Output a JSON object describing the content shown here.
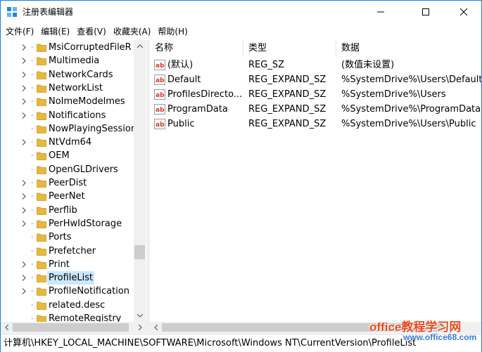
{
  "window": {
    "title": "注册表编辑器",
    "controls": {
      "minimize": "minimize-icon",
      "maximize": "maximize-icon",
      "close": "close-icon"
    }
  },
  "menu": [
    "文件(F)",
    "编辑(E)",
    "查看(V)",
    "收藏夹(A)",
    "帮助(H)"
  ],
  "tree": {
    "items": [
      {
        "label": "MsiCorruptedFileR",
        "expandable": true
      },
      {
        "label": "Multimedia",
        "expandable": true
      },
      {
        "label": "NetworkCards",
        "expandable": true
      },
      {
        "label": "NetworkList",
        "expandable": true
      },
      {
        "label": "NoImeModelmes",
        "expandable": true
      },
      {
        "label": "Notifications",
        "expandable": true
      },
      {
        "label": "NowPlayingSession",
        "expandable": false
      },
      {
        "label": "NtVdm64",
        "expandable": true
      },
      {
        "label": "OEM",
        "expandable": false
      },
      {
        "label": "OpenGLDrivers",
        "expandable": false
      },
      {
        "label": "PeerDist",
        "expandable": true
      },
      {
        "label": "PeerNet",
        "expandable": true
      },
      {
        "label": "Perflib",
        "expandable": true
      },
      {
        "label": "PerHwIdStorage",
        "expandable": true
      },
      {
        "label": "Ports",
        "expandable": false
      },
      {
        "label": "Prefetcher",
        "expandable": false
      },
      {
        "label": "Print",
        "expandable": true
      },
      {
        "label": "ProfileList",
        "expandable": true,
        "selected": true
      },
      {
        "label": "ProfileNotification",
        "expandable": true
      },
      {
        "label": "related.desc",
        "expandable": false
      },
      {
        "label": "RemoteRegistry",
        "expandable": false
      }
    ]
  },
  "list": {
    "columns": {
      "name": "名称",
      "type": "类型",
      "data": "数据"
    },
    "rows": [
      {
        "name": "(默认)",
        "type": "REG_SZ",
        "data": "(数值未设置)"
      },
      {
        "name": "Default",
        "type": "REG_EXPAND_SZ",
        "data": "%SystemDrive%\\Users\\Default"
      },
      {
        "name": "ProfilesDirecto...",
        "type": "REG_EXPAND_SZ",
        "data": "%SystemDrive%\\Users"
      },
      {
        "name": "ProgramData",
        "type": "REG_EXPAND_SZ",
        "data": "%SystemDrive%\\ProgramData"
      },
      {
        "name": "Public",
        "type": "REG_EXPAND_SZ",
        "data": "%SystemDrive%\\Users\\Public"
      }
    ]
  },
  "status": {
    "path": "计算机\\HKEY_LOCAL_MACHINE\\SOFTWARE\\Microsoft\\Windows NT\\CurrentVersion\\ProfileList"
  },
  "watermark": {
    "main": "office教程学习网",
    "sub": "www.office68.com"
  },
  "colors": {
    "accent": "#1883d7",
    "selection": "#cce8ff",
    "folder": "#e8b83a",
    "watermark_red": "#e8491d",
    "watermark_blue": "#3a7bd5"
  }
}
